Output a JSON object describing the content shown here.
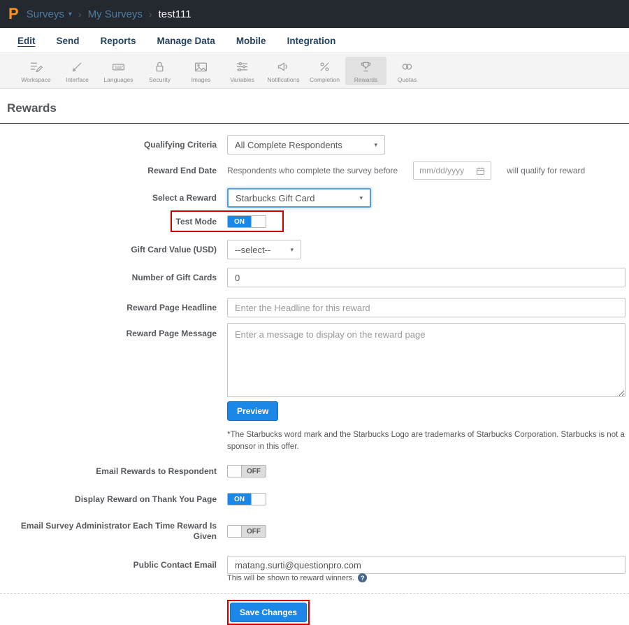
{
  "topbar": {
    "logo_text": "P",
    "surveys_label": "Surveys",
    "my_surveys_label": "My Surveys",
    "survey_name": "test111"
  },
  "icons": {
    "caret_down": "▾",
    "breadcrumb_separator": "›",
    "help": "?"
  },
  "menu": {
    "items": [
      {
        "label": "Edit"
      },
      {
        "label": "Send"
      },
      {
        "label": "Reports"
      },
      {
        "label": "Manage Data"
      },
      {
        "label": "Mobile"
      },
      {
        "label": "Integration"
      }
    ],
    "active": "Edit"
  },
  "toolbar": {
    "items": [
      {
        "label": "Workspace",
        "icon": "workspace-icon"
      },
      {
        "label": "Interface",
        "icon": "interface-icon"
      },
      {
        "label": "Languages",
        "icon": "languages-icon"
      },
      {
        "label": "Security",
        "icon": "security-icon"
      },
      {
        "label": "Images",
        "icon": "images-icon"
      },
      {
        "label": "Variables",
        "icon": "variables-icon"
      },
      {
        "label": "Notifications",
        "icon": "notifications-icon"
      },
      {
        "label": "Completion",
        "icon": "completion-icon"
      },
      {
        "label": "Rewards",
        "icon": "rewards-icon"
      },
      {
        "label": "Quotas",
        "icon": "quotas-icon"
      }
    ],
    "active": "Rewards"
  },
  "page": {
    "title": "Rewards"
  },
  "form": {
    "qualifying_criteria": {
      "label": "Qualifying Criteria",
      "value": "All Complete Respondents"
    },
    "reward_end_date": {
      "label": "Reward End Date",
      "prefix": "Respondents who complete the survey before",
      "placeholder": "mm/dd/yyyy",
      "suffix": "will qualify for reward"
    },
    "select_reward": {
      "label": "Select a Reward",
      "value": "Starbucks Gift Card"
    },
    "test_mode": {
      "label": "Test Mode",
      "state": "ON"
    },
    "gift_card_value": {
      "label": "Gift Card Value (USD)",
      "value": "--select--"
    },
    "number_of_gift_cards": {
      "label": "Number of Gift Cards",
      "value": "0"
    },
    "reward_page_headline": {
      "label": "Reward Page Headline",
      "placeholder": "Enter the Headline for this reward"
    },
    "reward_page_message": {
      "label": "Reward Page Message",
      "placeholder": "Enter a message to display on the reward page"
    },
    "preview_button": "Preview",
    "disclaimer": "*The Starbucks word mark and the Starbucks Logo are trademarks of Starbucks Corporation. Starbucks is not a sponsor in this offer.",
    "email_rewards_to_respondent": {
      "label": "Email Rewards to Respondent",
      "state": "OFF"
    },
    "display_reward_on_thank_you_page": {
      "label": "Display Reward on Thank You Page",
      "state": "ON"
    },
    "email_survey_administrator": {
      "label": "Email Survey Administrator Each Time Reward Is Given",
      "state": "OFF"
    },
    "public_contact_email": {
      "label": "Public Contact Email",
      "value": "matang.surti@questionpro.com",
      "help_text": "This will be shown to reward winners."
    },
    "save_button": "Save Changes"
  },
  "colors": {
    "accent_blue": "#1b87e6",
    "annotation_red": "#cc0000",
    "topbar_bg": "#24282f"
  }
}
